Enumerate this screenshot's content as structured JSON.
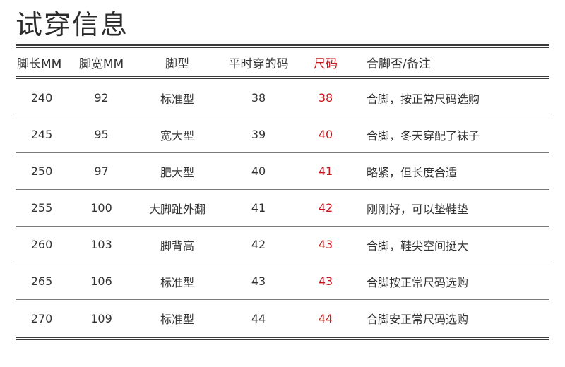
{
  "title": "试穿信息",
  "accent_color": "#c8161d",
  "columns": [
    "脚长MM",
    "脚宽MM",
    "脚型",
    "平时穿的码",
    "尺码",
    "合脚否/备注"
  ],
  "rows": [
    [
      "240",
      "92",
      "标准型",
      "38",
      "38",
      "合脚，按正常尺码选购"
    ],
    [
      "245",
      "95",
      "宽大型",
      "39",
      "40",
      "合脚，冬天穿配了袜子"
    ],
    [
      "250",
      "97",
      "肥大型",
      "40",
      "41",
      "略紧，但长度合适"
    ],
    [
      "255",
      "100",
      "大脚趾外翻",
      "41",
      "42",
      "刚刚好，可以垫鞋垫"
    ],
    [
      "260",
      "103",
      "脚背高",
      "42",
      "43",
      "合脚，鞋尖空间挺大"
    ],
    [
      "265",
      "106",
      "标准型",
      "43",
      "43",
      "合脚按正常尺码选购"
    ],
    [
      "270",
      "109",
      "标准型",
      "44",
      "44",
      "合脚安正常尺码选购"
    ]
  ]
}
